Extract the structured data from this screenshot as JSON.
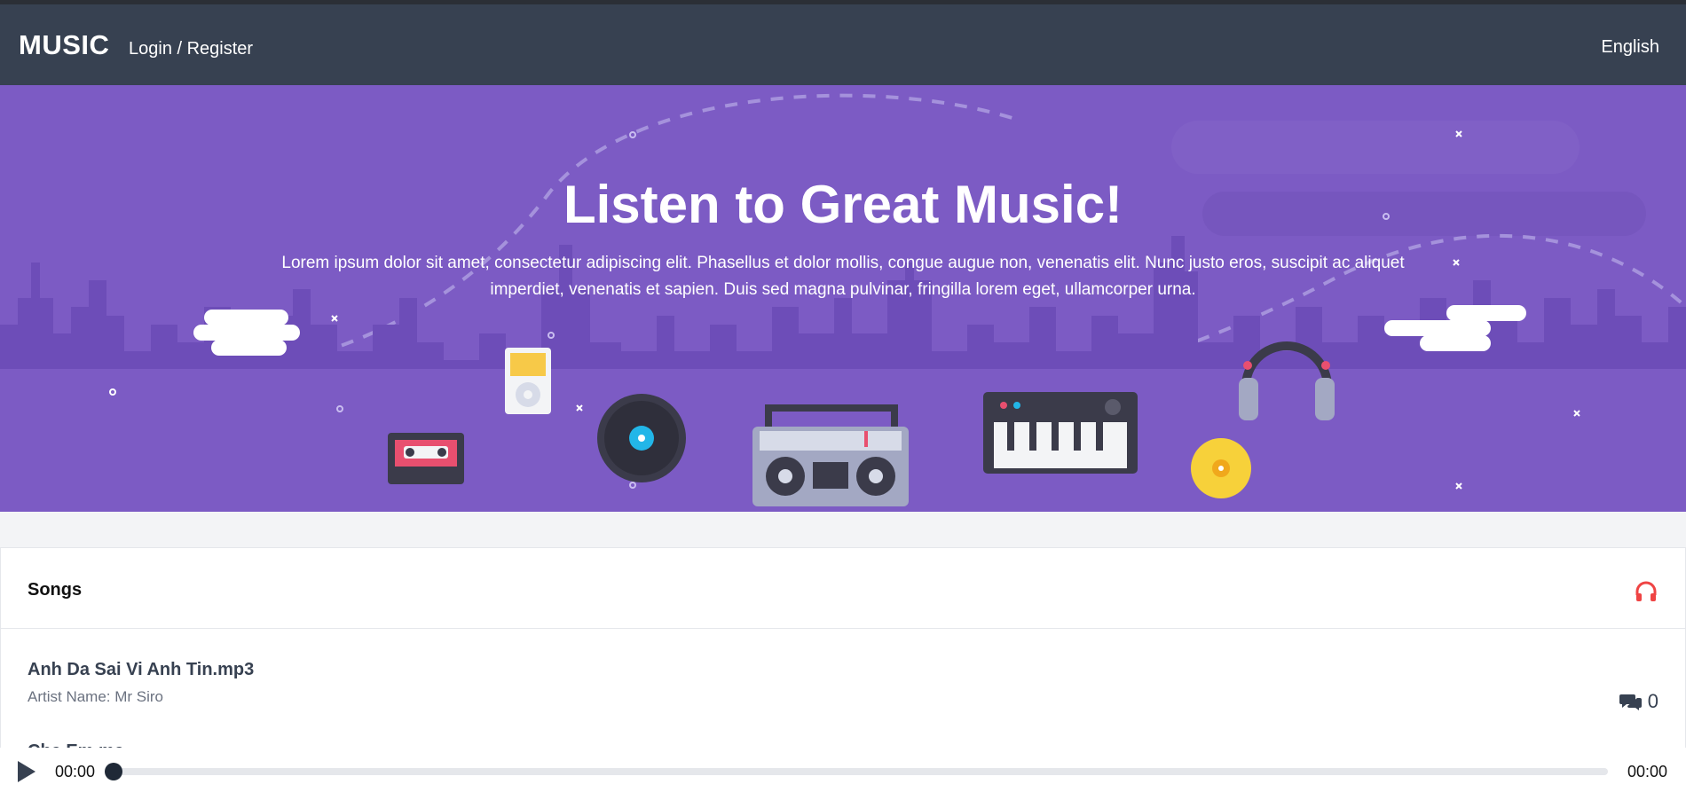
{
  "navbar": {
    "brand": "MUSIC",
    "login_register": "Login / Register",
    "language": "English"
  },
  "hero": {
    "title": "Listen to Great Music!",
    "description": "Lorem ipsum dolor sit amet, consectetur adipiscing elit. Phasellus et dolor mollis, congue augue non, venenatis elit. Nunc justo eros, suscipit ac aliquet imperdiet, venenatis et sapien. Duis sed magna pulvinar, fringilla lorem eget, ullamcorper urna."
  },
  "songs_panel": {
    "title": "Songs",
    "icon": "headphones-icon",
    "songs": [
      {
        "title": "Anh Da Sai Vi Anh Tin.mp3",
        "artist": "Artist Name: Mr Siro",
        "comments": "0"
      },
      {
        "title": "Che Em ma"
      }
    ]
  },
  "player": {
    "current_time": "00:00",
    "duration": "00:00",
    "progress": 0
  },
  "colors": {
    "navbar": "#374151",
    "hero": "#7c5bc4",
    "accent_red": "#ef4444"
  }
}
